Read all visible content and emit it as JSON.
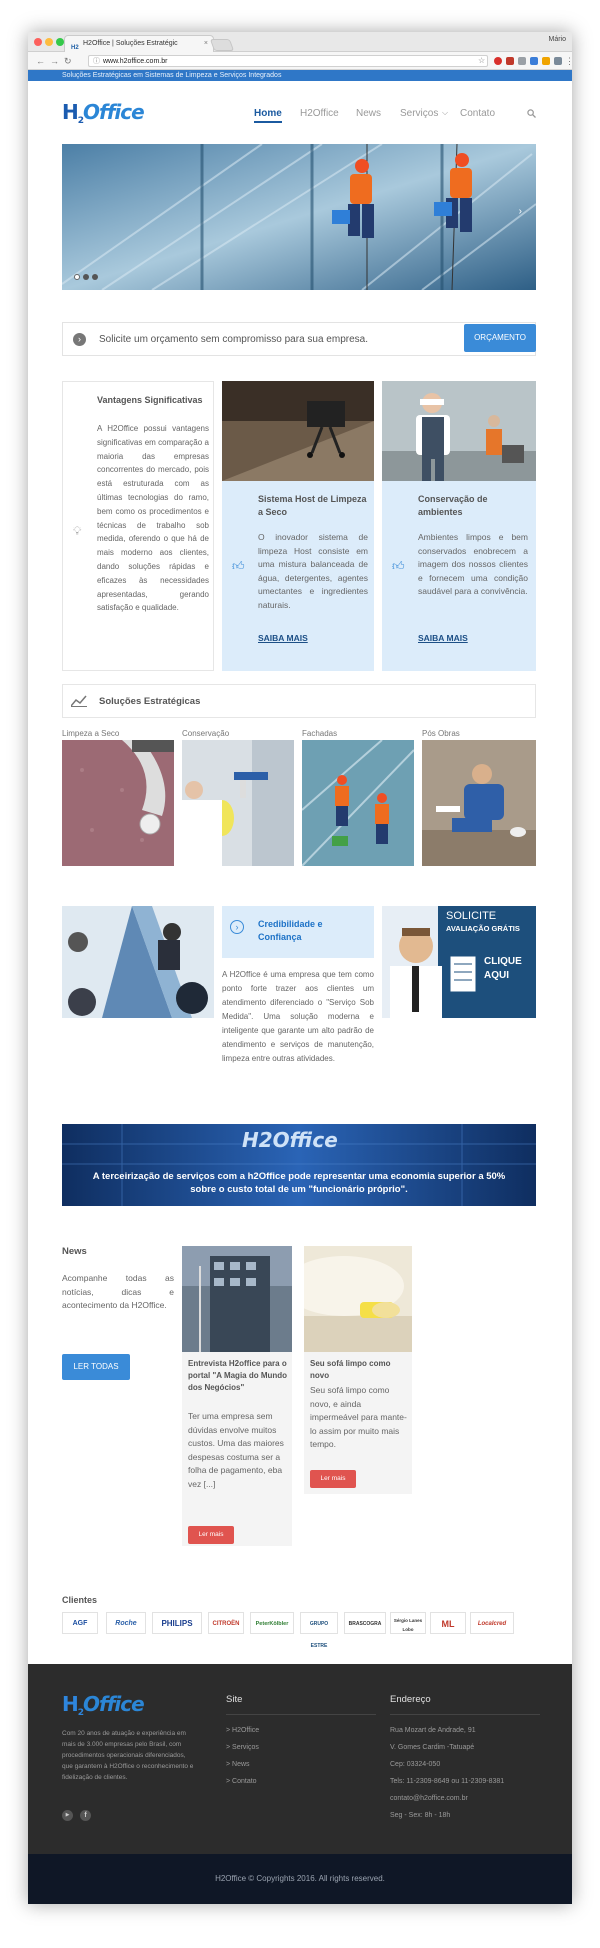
{
  "browser": {
    "tab_title": "H2Office | Soluções Estratégic",
    "tab_close": "×",
    "user": "Mário",
    "url": "www.h2office.com.br",
    "favicon_text": "H2"
  },
  "topbar": {
    "tagline": "Soluções Estratégicas em Sistemas de Limpeza e Serviços Integrados"
  },
  "logo": {
    "h": "H",
    "sub": "2",
    "rest": "Office",
    "footer_h": "H",
    "footer_sub": "2",
    "footer_rest": "Office"
  },
  "nav": {
    "items": [
      "Home",
      "H2Office",
      "News",
      "Serviços",
      "Contato"
    ],
    "dropdown_glyph": "⌵"
  },
  "quote": {
    "text": "Solicite um orçamento sem compromisso para sua empresa.",
    "button": "ORÇAMENTO"
  },
  "advantages": {
    "title": "Vantagens Significativas",
    "text": "A H2Office possui vantagens significativas em comparação a maioria das empresas concorrentes do mercado, pois está estruturada com as últimas tecnologias do ramo, bem como os procedimentos e técnicas de trabalho sob medida, oferendo o que há de mais moderno aos clientes, dando soluções rápidas e eficazes às necessidades apresentadas, gerando satisfação e qualidade."
  },
  "cards": [
    {
      "title": "Sistema Host de Limpeza a Seco",
      "text": "O inovador sistema de limpeza Host consiste em uma mistura balanceada de água, detergentes, agentes umectantes e ingredientes naturais.",
      "link": "SAIBA MAIS"
    },
    {
      "title": "Conservação de ambientes",
      "text": "Ambientes limpos e bem conservados enobrecem a imagem dos nossos clientes e fornecem uma condição saudável para a convivência.",
      "link": "SAIBA MAIS"
    }
  ],
  "solutions": {
    "title": "Soluções Estratégicas",
    "items": [
      "Limpeza a Seco",
      "Conservação",
      "Fachadas",
      "Pós Obras"
    ]
  },
  "credibility": {
    "title": "Credibilidade e Confiança",
    "text": "A H2Office é uma empresa que tem como ponto forte trazer aos clientes um atendimento diferenciado o \"Serviço Sob Medida\". Uma solução moderna e inteligente que garante um alto padrão de atendimento e serviços de manutenção, limpeza entre outras atividades."
  },
  "promo": {
    "line1": "SOLICITE",
    "line2": "AVALIAÇÃO GRÁTIS",
    "line3": "CLIQUE",
    "line4": "AQUI"
  },
  "banner": {
    "text": "A terceirização de serviços com a h2Office pode representar uma economia superior a 50% sobre o custo total de um \"funcionário próprio\".",
    "logo_text": "H2Office"
  },
  "news": {
    "title": "News",
    "intro": "Acompanhe todas as notícias, dicas e acontecimento da H2Office.",
    "button": "LER TODAS",
    "posts": [
      {
        "title": "Entrevista H2office para o portal \"A Magia do Mundo dos Negócios\"",
        "excerpt": "Ter uma empresa sem dúvidas envolve muitos custos. Uma das maiores despesas costuma ser a folha de pagamento, eba vez [...]",
        "button": "Ler mais"
      },
      {
        "title": "Seu sofá limpo como novo",
        "excerpt": "Seu sofá limpo como novo, e ainda impermeável para mante-lo assim por muito mais tempo.",
        "button": "Ler mais"
      }
    ]
  },
  "clients": {
    "title": "Clientes",
    "logos": [
      "AGF",
      "Roche",
      "PHILIPS",
      "CITROËN",
      "PeterKölbler",
      "GRUPO ESTRE",
      "BRASCOGRA",
      "Sérgio Lanes Lobo",
      "ML",
      "Localcred"
    ]
  },
  "footer": {
    "about": "Com 20 anos de atuação e experiência em mais de 3.000 empresas pelo Brasil, com procedimentos operacionais diferenciados, que garantem à H2Office o reconhecimento e fidelização de clientes.",
    "site_title": "Site",
    "site_links": [
      "> H2Office",
      "> Serviços",
      "> News",
      "> Contato"
    ],
    "address_title": "Endereço",
    "address": [
      "Rua Mozart de Andrade, 91",
      "V. Gomes Cardim -Tatuapé",
      "Cep: 03324-050",
      "Tels: 11-2309-8649 ou 11-2309-8381",
      "contato@h2office.com.br",
      "Seg - Sex: 8h - 18h"
    ],
    "social": [
      "▶",
      "f"
    ],
    "copyright": "H2Office © Copyrights 2016. All rights reserved."
  },
  "colors": {
    "accent": "#2f77c7",
    "button": "#3a8bd8",
    "card_bg": "#dcecfa",
    "red": "#e0544f",
    "footer": "#2c2c2c"
  }
}
